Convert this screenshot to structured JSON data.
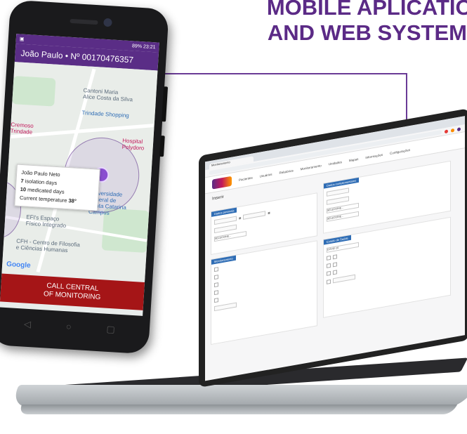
{
  "headline": {
    "line1": "MOBILE APLICATION",
    "line2": "AND WEB SYSTEM"
  },
  "phone": {
    "status_time": "23:21",
    "status_battery": "89%",
    "app_title": "João Paulo • Nº 00170476357",
    "map": {
      "pois": [
        "Cantoni Maria\nAlice Costa da Silva",
        "Trindade Shopping",
        "Hospital\nPolydoro",
        "Universidade\nFederal de\nSanta Catarina\nCampus",
        "EFI's Espaço\nFísico Integrado",
        "CFH - Centro de Filosofia\ne Ciências Humanas",
        "Cremoso\nTrindade"
      ],
      "google_label": "Google"
    },
    "info_card": {
      "name": "João Paulo Neto",
      "isolation_value": "7",
      "isolation_label": "isolation days",
      "medicated_value": "10",
      "medicated_label": "medicated days",
      "temperature_label": "Current temperature",
      "temperature_value": "38°"
    },
    "call_button": {
      "line1": "CALL CENTRAL",
      "line2": "OF MONITORING"
    },
    "nav": {
      "back": "◁",
      "home": "○",
      "recent": "▢"
    }
  },
  "laptop": {
    "tab_label": "Monitoramento",
    "nav_items": [
      "Pacientes",
      "Usuários",
      "Relatórios",
      "Monitoramento",
      "Unidades",
      "Mapas",
      "Informações",
      "Configurações"
    ],
    "page_title": "Inserir",
    "sections": {
      "personal": "Dados pessoais",
      "monitoring": "Monitoramento",
      "complementary": "Dados complementares",
      "clinical": "Estado de Saúde"
    },
    "field_select": "SELECIONE...",
    "field_select_state": "COVID-19",
    "colors": {
      "accent": "#5a2d86",
      "section_header": "#2f6db5",
      "call_button": "#a51517"
    }
  }
}
